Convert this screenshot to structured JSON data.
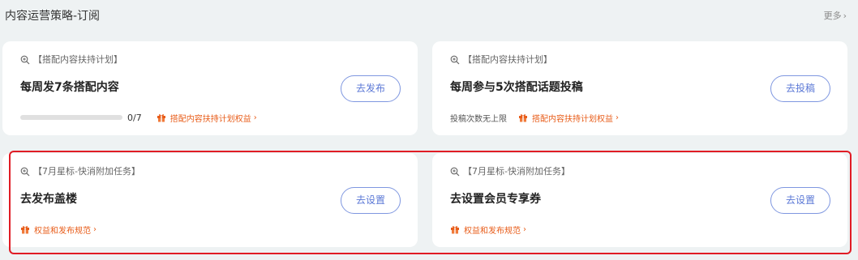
{
  "header": {
    "title": "内容运营策略-订阅",
    "more_label": "更多",
    "more_chevron": "›"
  },
  "cards": [
    {
      "tag": "【搭配内容扶持计划】",
      "title": "每周发7条搭配内容",
      "button": "去发布",
      "progress": {
        "count_text": "0/7",
        "fraction": 0
      },
      "benefit": "搭配内容扶持计划权益",
      "chevron": "›"
    },
    {
      "tag": "【搭配内容扶持计划】",
      "title": "每周参与5次搭配话题投稿",
      "button": "去投稿",
      "note": "投稿次数无上限",
      "benefit": "搭配内容扶持计划权益",
      "chevron": "›"
    },
    {
      "tag": "【7月星标-快消附加任务】",
      "title": "去发布盖楼",
      "button": "去设置",
      "benefit": "权益和发布规范",
      "chevron": "›"
    },
    {
      "tag": "【7月星标-快消附加任务】",
      "title": "去设置会员专享券",
      "button": "去设置",
      "benefit": "权益和发布规范",
      "chevron": "›"
    }
  ],
  "colors": {
    "accent": "#5b78d6",
    "benefit": "#e85d1a",
    "highlight": "#e01c25",
    "background": "#eef2f3"
  },
  "icons": {
    "tag": "search-plus-icon",
    "benefit": "gift-icon"
  }
}
